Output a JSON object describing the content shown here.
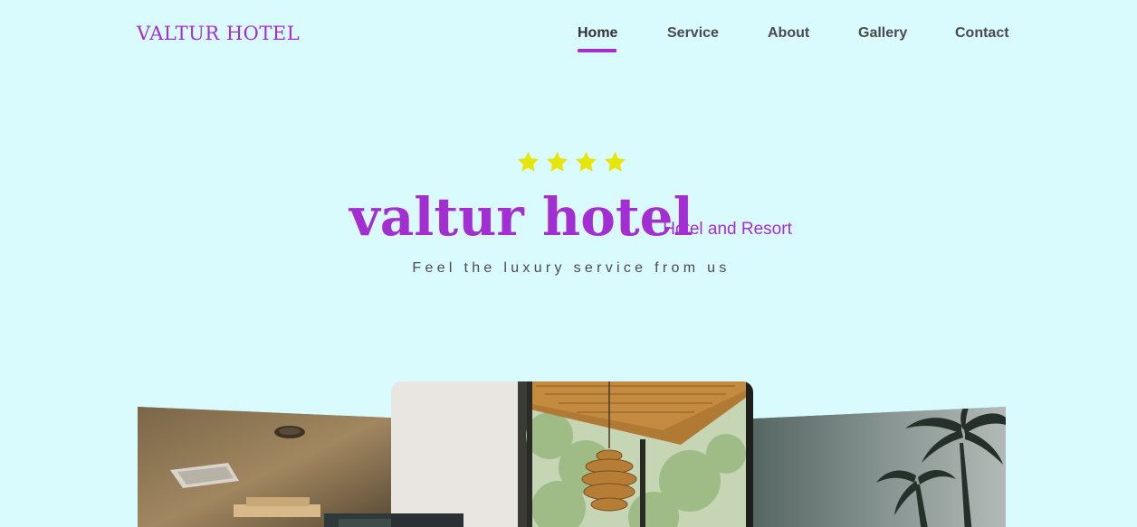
{
  "header": {
    "logo": "VALTUR HOTEL",
    "nav": [
      {
        "label": "Home",
        "active": true
      },
      {
        "label": "Service",
        "active": false
      },
      {
        "label": "About",
        "active": false
      },
      {
        "label": "Gallery",
        "active": false
      },
      {
        "label": "Contact",
        "active": false
      }
    ]
  },
  "hero": {
    "rating": 4,
    "title": "valtur hotel",
    "subtitle": ".Hotel and Resort",
    "tagline": "Feel the luxury service from us"
  },
  "colors": {
    "background": "#dafbfe",
    "accent": "#a32fd2",
    "star": "#e6e60c",
    "text": "#4a4a4a"
  },
  "gallery": {
    "images": [
      "hotel-lobby-ceiling-photo",
      "hotel-interior-chandelier-photo",
      "palm-trees-photo"
    ]
  }
}
